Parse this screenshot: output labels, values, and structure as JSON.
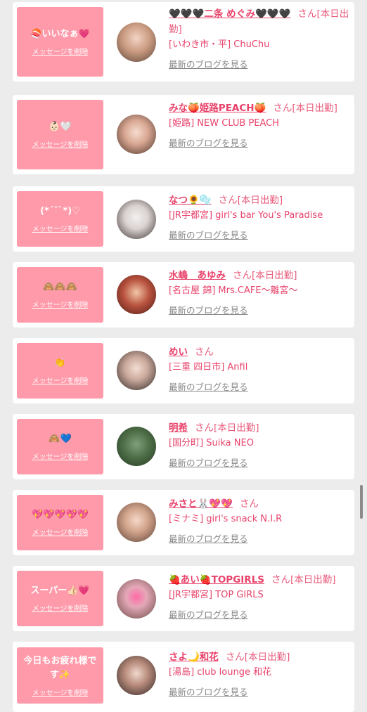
{
  "delete_label": "メッセージを削除",
  "blog_label": "最新のブログを見る",
  "san_suffix": "さん",
  "cards": [
    {
      "stamp_text": "🍣いいなぁ💗",
      "name": "🖤🖤🖤二条 めぐみ🖤🖤🖤",
      "status": "さん[本日出勤]",
      "shop": "[いわき市・平] ChuChu"
    },
    {
      "stamp_text": "👶🏻🤍",
      "name": "みな🍑姫路PEACH🍑",
      "status": "さん[本日出勤]",
      "shop": "[姫路] NEW CLUB PEACH"
    },
    {
      "stamp_text": "(*ˊ˘ˋ*)♡",
      "name": "なつ🌻🫧",
      "status": "さん[本日出勤]",
      "shop": "[JR宇都宮] girl's bar You's Paradise"
    },
    {
      "stamp_text": "🙈🙈🙈",
      "name": "水嶋　あゆみ",
      "status": "さん[本日出勤]",
      "shop": "[名古屋 錦] Mrs.CAFE〜離宮〜"
    },
    {
      "stamp_text": "👏",
      "name": "めい",
      "status": "さん",
      "shop": "[三重 四日市] Anfil"
    },
    {
      "stamp_text": "🙈💙",
      "name": "明希",
      "status": "さん[本日出勤]",
      "shop": "[国分町] Suika NEO"
    },
    {
      "stamp_text": "💖💖💖💖💖",
      "name": "みさと🐰💖💖",
      "status": "さん",
      "shop": "[ミナミ] girl's snack N.I.R"
    },
    {
      "stamp_text": "スーパー👍🏻💗",
      "name": "🍓あい🍓TOPGIRLS",
      "status": "さん[本日出勤]",
      "shop": "[JR宇都宮] TOP GIRLS"
    },
    {
      "stamp_text": "今日もお疲れ様です✨",
      "name": "さよ🌙和花",
      "status": "さん[本日出勤]",
      "shop": "[湯島] club lounge 和花"
    }
  ],
  "colors": {
    "background": "#ececec",
    "card": "#ffffff",
    "stamp": "#ff9aaa",
    "name": "#e8436b",
    "blog_link": "#888888"
  }
}
